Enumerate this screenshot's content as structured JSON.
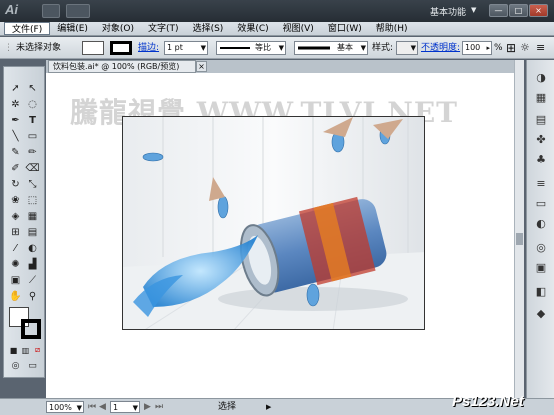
{
  "app": {
    "logo": "Ai",
    "workspace": "基本功能",
    "window_buttons": [
      "—",
      "□",
      "×"
    ]
  },
  "menu": [
    "文件(F)",
    "编辑(E)",
    "对象(O)",
    "文字(T)",
    "选择(S)",
    "效果(C)",
    "视图(V)",
    "窗口(W)",
    "帮助(H)"
  ],
  "control": {
    "selection": "未选择对象",
    "stroke_label": "描边:",
    "stroke_value": "1 pt",
    "profile": "等比",
    "brush": "基本",
    "style_label": "样式:",
    "opacity_label": "不透明度:",
    "opacity_value": "100",
    "percent": "%"
  },
  "document": {
    "tab": "饮料包装.ai* @ 100% (RGB/预览)",
    "close": "×"
  },
  "watermark": "騰龍視覺 WWW.TLVI.NET",
  "status": {
    "zoom": "100%",
    "page": "1",
    "tool": "选择"
  },
  "corner_watermark": "Ps123.Net",
  "colors": {
    "accent": "#3a7fd0",
    "menubar": "#2c343c",
    "panel": "#d4dbe1"
  }
}
